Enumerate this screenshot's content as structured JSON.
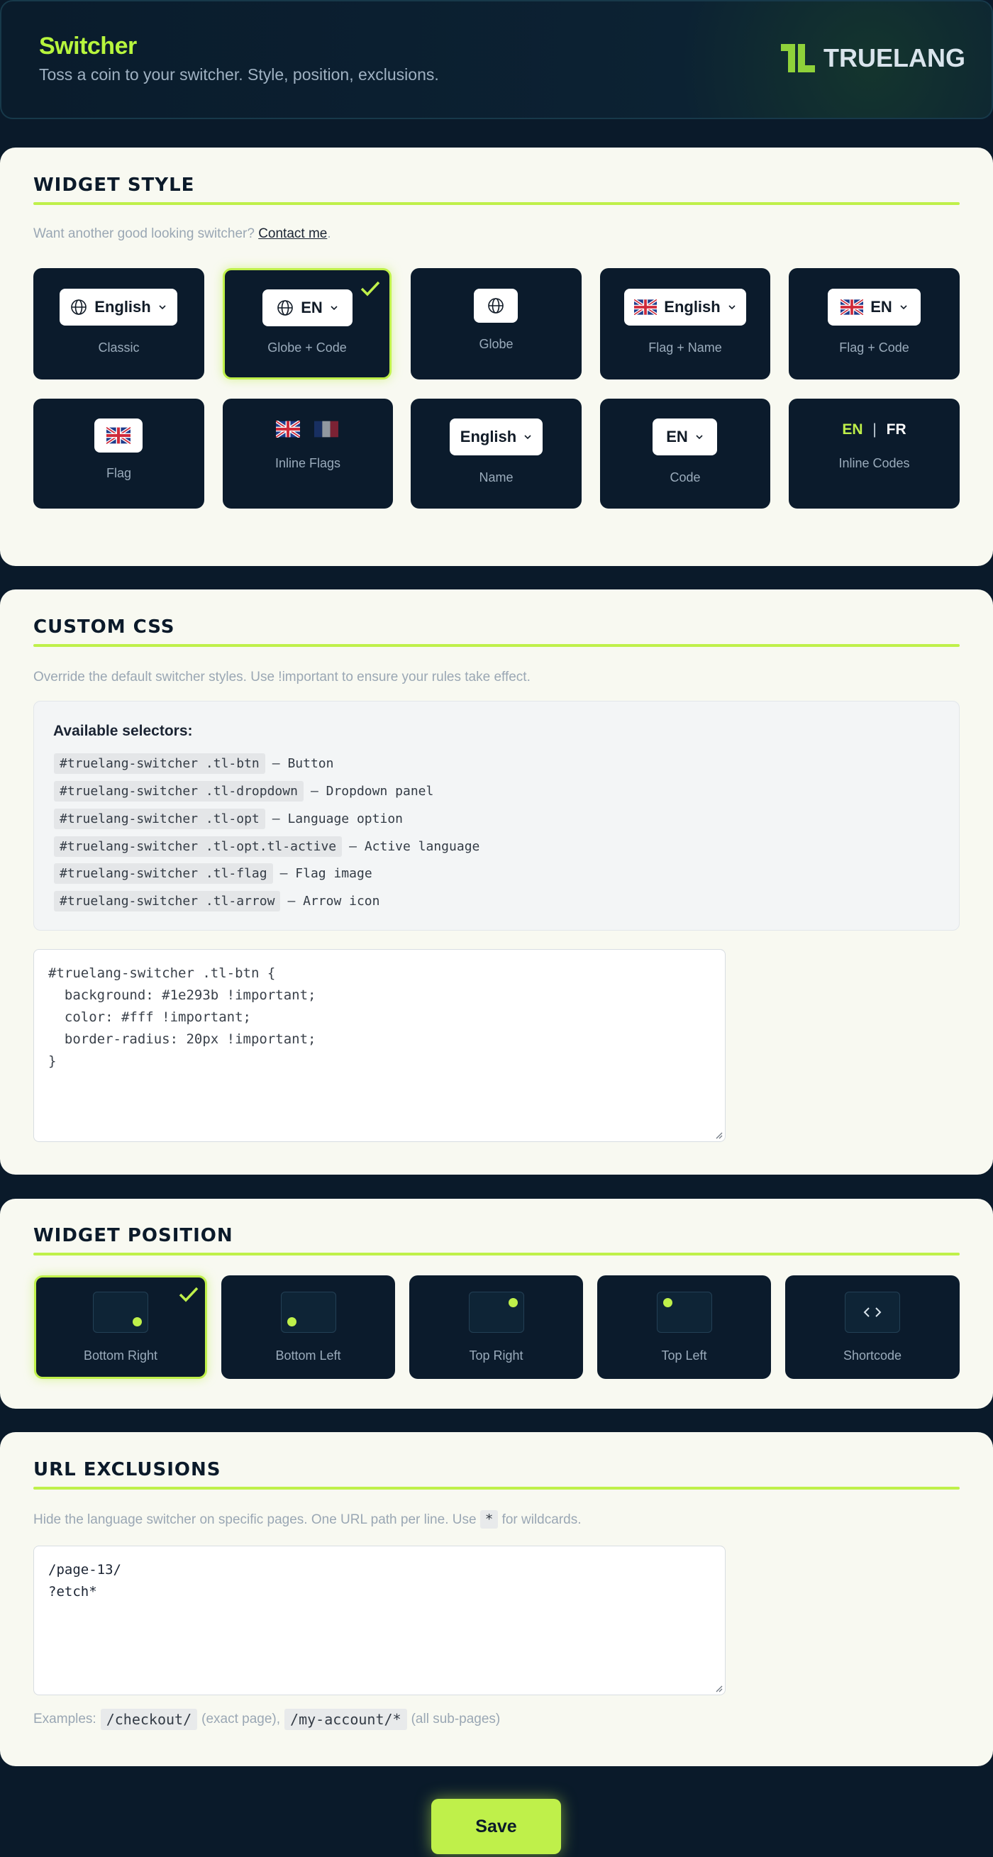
{
  "header": {
    "title": "Switcher",
    "subtitle": "Toss a coin to your switcher. Style, position, exclusions.",
    "logo_text": "TRUELANG"
  },
  "widget_style": {
    "title": "WIDGET STYLE",
    "hint_prefix": "Want another good looking switcher? ",
    "hint_link": "Contact me",
    "hint_suffix": ".",
    "selected": "Globe + Code",
    "options": [
      {
        "label": "Classic",
        "preview": "English"
      },
      {
        "label": "Globe + Code",
        "preview": "EN"
      },
      {
        "label": "Globe",
        "preview": ""
      },
      {
        "label": "Flag + Name",
        "preview": "English"
      },
      {
        "label": "Flag + Code",
        "preview": "EN"
      },
      {
        "label": "Flag",
        "preview": ""
      },
      {
        "label": "Inline Flags",
        "preview": ""
      },
      {
        "label": "Name",
        "preview": "English"
      },
      {
        "label": "Code",
        "preview": "EN"
      },
      {
        "label": "Inline Codes",
        "preview_a": "EN",
        "preview_sep": "|",
        "preview_b": "FR"
      }
    ]
  },
  "custom_css": {
    "title": "CUSTOM CSS",
    "hint": "Override the default switcher styles. Use !important to ensure your rules take effect.",
    "selectors_heading": "Available selectors:",
    "selectors": [
      {
        "code": "#truelang-switcher .tl-btn",
        "desc": "— Button"
      },
      {
        "code": "#truelang-switcher .tl-dropdown",
        "desc": "— Dropdown panel"
      },
      {
        "code": "#truelang-switcher .tl-opt",
        "desc": "— Language option"
      },
      {
        "code": "#truelang-switcher .tl-opt.tl-active",
        "desc": "— Active language"
      },
      {
        "code": "#truelang-switcher .tl-flag",
        "desc": "— Flag image"
      },
      {
        "code": "#truelang-switcher .tl-arrow",
        "desc": "— Arrow icon"
      }
    ],
    "editor_value": "#truelang-switcher .tl-btn {\n  background: #1e293b !important;\n  color: #fff !important;\n  border-radius: 20px !important;\n}"
  },
  "widget_position": {
    "title": "WIDGET POSITION",
    "selected": "Bottom Right",
    "options": [
      "Bottom Right",
      "Bottom Left",
      "Top Right",
      "Top Left",
      "Shortcode"
    ]
  },
  "url_exclusions": {
    "title": "URL EXCLUSIONS",
    "hint_prefix": "Hide the language switcher on specific pages. One URL path per line. Use",
    "hint_code": "*",
    "hint_suffix": "for wildcards.",
    "editor_value": "/page-13/\n?etch*",
    "examples_label": "Examples:",
    "example_1": "/checkout/",
    "example_1_note": "(exact page),",
    "example_2": "/my-account/*",
    "example_2_note": "(all sub-pages)"
  },
  "save_label": "Save",
  "colors": {
    "accent": "#bff04a",
    "dark": "#0b1b2c",
    "panel": "#f8f9f1"
  }
}
